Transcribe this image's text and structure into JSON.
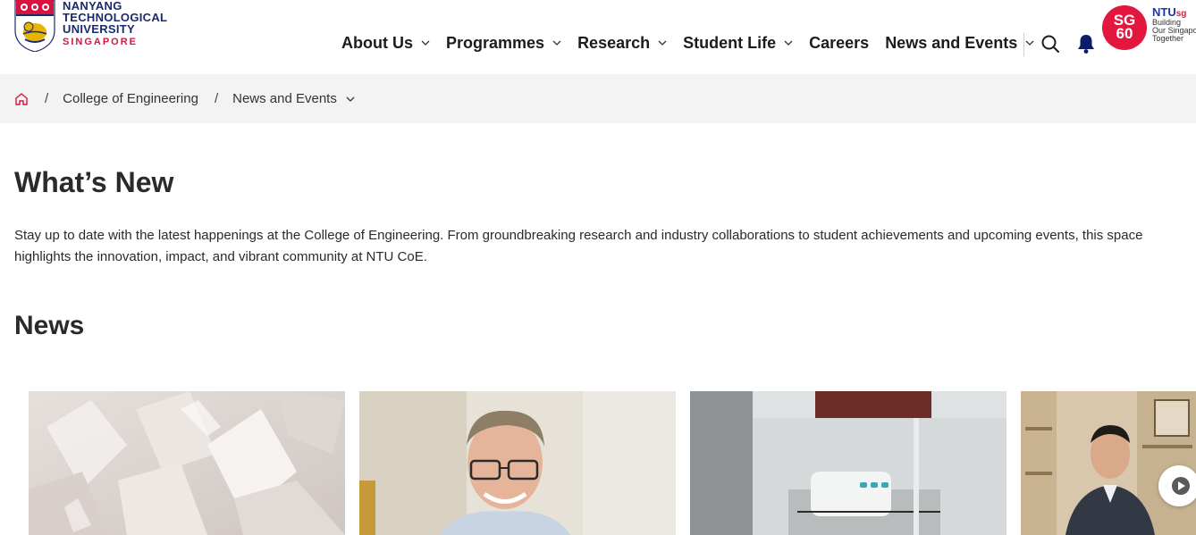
{
  "logo": {
    "line1": "NANYANG",
    "line2": "TECHNOLOGICAL",
    "line3": "UNIVERSITY",
    "line4": "SINGAPORE"
  },
  "nav": {
    "items": [
      {
        "label": "About Us",
        "has_dropdown": true
      },
      {
        "label": "Programmes",
        "has_dropdown": true
      },
      {
        "label": "Research",
        "has_dropdown": true
      },
      {
        "label": "Student Life",
        "has_dropdown": true
      },
      {
        "label": "Careers",
        "has_dropdown": false
      },
      {
        "label": "News and Events",
        "has_dropdown": true
      }
    ],
    "search_icon": "search-icon",
    "notification_icon": "bell-icon"
  },
  "sg60": {
    "badge_line1": "SG",
    "badge_line2": "60",
    "brand": "NTU",
    "brand_suffix": "sg",
    "tagline1": "Building",
    "tagline2": "Our Singapore",
    "tagline3": "Together"
  },
  "breadcrumb": {
    "home_icon": "home-icon",
    "separator": "/",
    "items": [
      "College of Engineering",
      "News and Events"
    ]
  },
  "main": {
    "title": "What’s New",
    "intro": "Stay up to date with the latest happenings at the College of Engineering. From groundbreaking research and industry collaborations to student achievements and upcoming events, this space highlights the innovation, impact, and vibrant community at NTU CoE.",
    "news_heading": "News"
  },
  "colors": {
    "brand_navy": "#1a2a6c",
    "brand_red": "#d71440",
    "breadcrumb_bg": "#f3f3f3"
  }
}
